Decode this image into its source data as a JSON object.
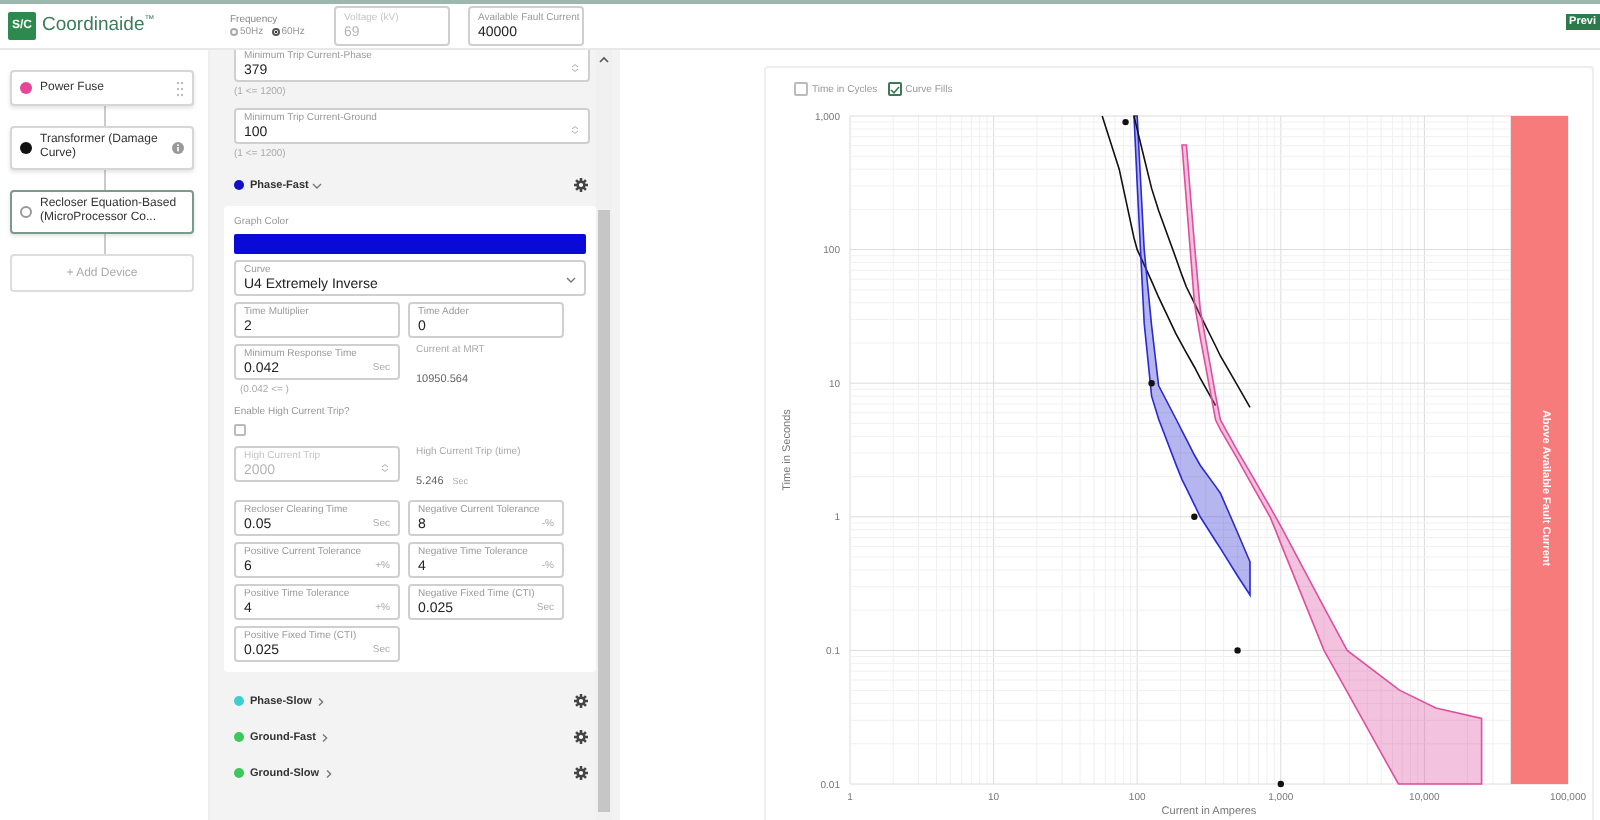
{
  "header": {
    "logo_mark": "S/C",
    "app_name": "Coordinaide$^{™}$",
    "frequency": {
      "label": "Frequency",
      "options": [
        {
          "label": "50Hz",
          "selected": false
        },
        {
          "label": "60Hz",
          "selected": true
        }
      ]
    },
    "voltage": {
      "label": "Voltage (kV)",
      "value": "69",
      "disabled": true
    },
    "fault_current": {
      "label": "Available Fault Current",
      "value": "40000",
      "disabled": false
    },
    "badge": "Previ"
  },
  "devices": [
    {
      "name": "Power Fuse",
      "color": "#e8449a",
      "selected": false
    },
    {
      "name": "Transformer (Damage Curve)",
      "color": "#111111",
      "selected": false
    },
    {
      "name": "Recloser Equation-Based (MicroProcessor Co...",
      "color": "#ffffff",
      "selected": true
    }
  ],
  "add_device": "+ Add Device",
  "settings": {
    "fields": [
      {
        "label": "Minimum Trip Current-Phase",
        "value": "379",
        "hint": "(1 <= 1200)"
      },
      {
        "label": "Minimum Trip Current-Ground",
        "value": "100",
        "hint": "(1 <= 1200)"
      }
    ],
    "groups": [
      {
        "name": "Phase-Fast",
        "color": "#1010c8",
        "expanded": true,
        "rows": [
          [
            {
              "kind": "color",
              "label": "Graph Color",
              "color": "#0a0ad8"
            }
          ],
          [
            {
              "kind": "select",
              "label": "Curve",
              "value": "U4 Extremely Inverse"
            }
          ],
          [
            {
              "kind": "input",
              "label": "Time Multiplier",
              "value": "2",
              "disabled": false
            },
            {
              "kind": "input",
              "label": "Time Adder",
              "value": "0",
              "disabled": false
            }
          ],
          [
            {
              "kind": "input",
              "label": "Minimum Response Time",
              "value": "0.042",
              "unit": "Sec",
              "hint": "(0.042 <= )",
              "disabled": false
            },
            {
              "kind": "readout",
              "label": "Current at MRT",
              "value": "10950.564"
            }
          ],
          [
            {
              "kind": "checkbox",
              "label": "Enable High Current Trip?",
              "checked": false
            }
          ],
          [
            {
              "kind": "number",
              "label": "High Current Trip",
              "value": "2000",
              "disabled": true
            },
            {
              "kind": "readout",
              "label": "High Current Trip (time)",
              "value": "5.246",
              "unit": "Sec"
            }
          ],
          [
            {
              "kind": "input",
              "label": "Recloser Clearing Time",
              "value": "0.05",
              "unit": "Sec",
              "disabled": false
            },
            {
              "kind": "input",
              "label": "Negative Current Tolerance",
              "value": "8",
              "unit": "-%",
              "disabled": false
            }
          ],
          [
            {
              "kind": "input",
              "label": "Positive Current Tolerance",
              "value": "6",
              "unit": "+%",
              "disabled": false
            },
            {
              "kind": "input",
              "label": "Negative Time Tolerance",
              "value": "4",
              "unit": "-%",
              "disabled": false
            }
          ],
          [
            {
              "kind": "input",
              "label": "Positive Time Tolerance",
              "value": "4",
              "unit": "+%",
              "disabled": false
            },
            {
              "kind": "input",
              "label": "Negative Fixed Time (CTI)",
              "value": "0.025",
              "unit": "Sec",
              "disabled": false
            }
          ],
          [
            {
              "kind": "input",
              "label": "Positive Fixed Time (CTI)",
              "value": "0.025",
              "unit": "Sec",
              "disabled": false
            }
          ]
        ]
      },
      {
        "name": "Phase-Slow",
        "color": "#3ccfcf",
        "expanded": false
      },
      {
        "name": "Ground-Fast",
        "color": "#3cc85a",
        "expanded": false
      },
      {
        "name": "Ground-Slow",
        "color": "#3cc85a",
        "expanded": false
      }
    ]
  },
  "chart": {
    "options": [
      {
        "label": "Time in Cycles",
        "checked": false
      },
      {
        "label": "Curve Fills",
        "checked": true
      }
    ],
    "plot": {
      "xlabel": "Current in Amperes",
      "ylabel": "Time in Seconds",
      "xticks": [
        "1",
        "10",
        "100",
        "1,000",
        "10,000",
        "100,000"
      ],
      "yticks": [
        "1,000",
        "100",
        "10",
        "1",
        "0.1",
        "0.01"
      ],
      "band_label": "Above Available Fault Current"
    }
  }
}
